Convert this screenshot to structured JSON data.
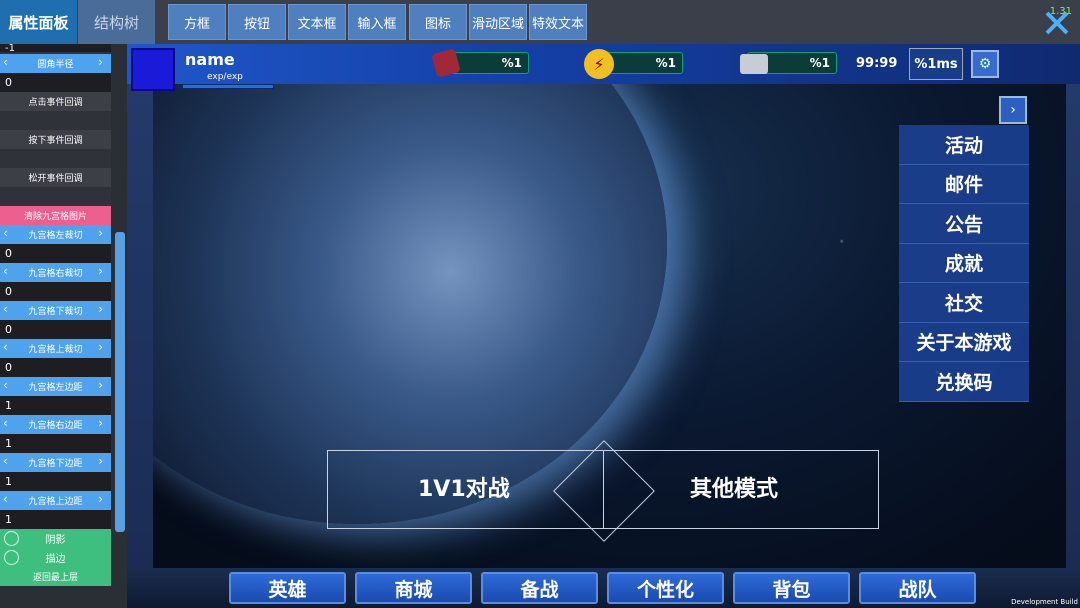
{
  "editor": {
    "panel_tabs": [
      "属性面板",
      "结构树"
    ],
    "toolbar": [
      "方框",
      "按钮",
      "文本框",
      "输入框",
      "图标",
      "滑动区域",
      "特效文本"
    ],
    "close_badge": "1.31"
  },
  "properties": {
    "top_value": "-1",
    "corner_radius": {
      "label": "圆角半径",
      "value": "0"
    },
    "callbacks": [
      "点击事件回调",
      "按下事件回调",
      "松开事件回调"
    ],
    "clear_button": "清除九宫格图片",
    "fields": [
      {
        "label": "九宫格左裁切",
        "value": "0"
      },
      {
        "label": "九宫格右裁切",
        "value": "0"
      },
      {
        "label": "九宫格下裁切",
        "value": "0"
      },
      {
        "label": "九宫格上裁切",
        "value": "0"
      },
      {
        "label": "九宫格左边距",
        "value": "1"
      },
      {
        "label": "九宫格右边距",
        "value": "1"
      },
      {
        "label": "九宫格下边距",
        "value": "1"
      },
      {
        "label": "九宫格上边距",
        "value": "1"
      }
    ],
    "toggles": [
      "阴影",
      "描边"
    ],
    "bring_top": "返回最上层"
  },
  "hud": {
    "name": "name",
    "exp": "exp/exp",
    "resources": [
      "%1",
      "%1",
      "%1"
    ],
    "timer": "99:99",
    "ping": "%1ms"
  },
  "side_menu": [
    "活动",
    "邮件",
    "公告",
    "成就",
    "社交",
    "关于本游戏",
    "兑换码"
  ],
  "modes": {
    "left": "1V1对战",
    "right": "其他模式"
  },
  "bottom_nav": [
    "英雄",
    "商城",
    "备战",
    "个性化",
    "背包",
    "战队"
  ],
  "dev_build": "Development Build",
  "colors": {
    "accent": "#1f6fb0",
    "panel_head": "#4fa3ee",
    "pink": "#ee5f8f",
    "green": "#3fbf7f"
  },
  "icons": {
    "close": "close-x-icon",
    "arrow_left": "chevron-left-icon",
    "arrow_right": "chevron-right-icon",
    "settings": "gear-icon",
    "expand": "chevron-right-icon"
  }
}
